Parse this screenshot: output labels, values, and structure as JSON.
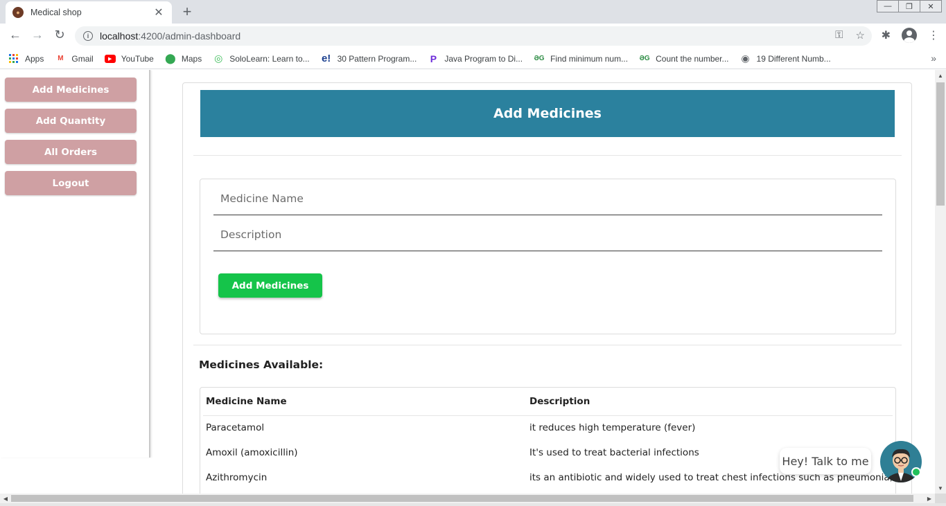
{
  "browser": {
    "tab_title": "Medical shop",
    "tab_close": "✕",
    "new_tab": "+",
    "url_host": "localhost",
    "url_path": ":4200/admin-dashboard",
    "bookmarks": [
      {
        "label": "Apps",
        "icon": "apps-grid-icon",
        "color": "#1a73e8"
      },
      {
        "label": "Gmail",
        "icon": "gmail-icon",
        "color": "#ea4335"
      },
      {
        "label": "YouTube",
        "icon": "youtube-icon",
        "color": "#ff0000"
      },
      {
        "label": "Maps",
        "icon": "maps-icon",
        "color": "#34a853"
      },
      {
        "label": "SoloLearn: Learn to...",
        "icon": "sololearn-icon",
        "color": "#3dbd5a"
      },
      {
        "label": "30 Pattern Program...",
        "icon": "edureka-icon",
        "color": "#1a3f8f"
      },
      {
        "label": "Java Program to Di...",
        "icon": "programiz-icon",
        "color": "#6c2bd9"
      },
      {
        "label": "Find minimum num...",
        "icon": "geeksforgeeks-icon",
        "color": "#2f8d46"
      },
      {
        "label": "Count the number...",
        "icon": "geeksforgeeks-icon",
        "color": "#2f8d46"
      },
      {
        "label": "19 Different Numb...",
        "icon": "globe-icon",
        "color": "#5f6368"
      }
    ]
  },
  "sidebar": {
    "items": [
      {
        "label": "Add Medicines"
      },
      {
        "label": "Add Quantity"
      },
      {
        "label": "All Orders"
      },
      {
        "label": "Logout"
      }
    ]
  },
  "main": {
    "header_title": "Add Medicines",
    "form": {
      "name_placeholder": "Medicine Name",
      "description_placeholder": "Description",
      "submit_label": "Add Medicines"
    },
    "section_title": "Medicines Available:",
    "table": {
      "columns": [
        "Medicine Name",
        "Description"
      ],
      "rows": [
        [
          "Paracetamol",
          "it reduces high temperature (fever)"
        ],
        [
          "Amoxil (amoxicillin)",
          "It's used to treat bacterial infections"
        ],
        [
          "Azithromycin",
          "its an antibiotic and widely used to treat chest infections such as pneumonia,"
        ]
      ]
    }
  },
  "chat": {
    "bubble_text": "Hey! Talk to me"
  },
  "colors": {
    "sidebar_button": "#cfa0a3",
    "header": "#2b819e",
    "submit_button": "#15c44a",
    "online": "#21c15a"
  }
}
